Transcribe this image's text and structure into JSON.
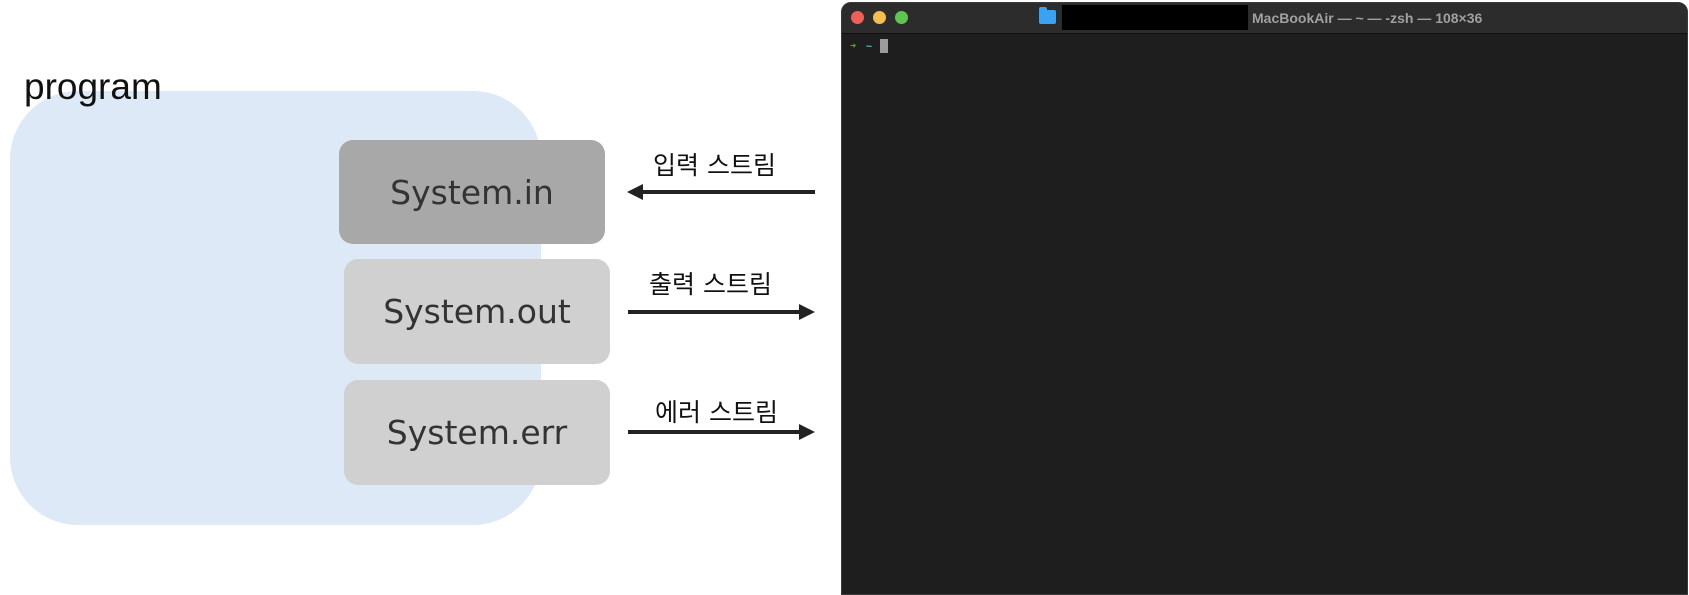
{
  "diagram": {
    "program_label": "program",
    "streams": [
      {
        "box_label": "System.in",
        "arrow_label": "입력 스트림",
        "direction": "into-program"
      },
      {
        "box_label": "System.out",
        "arrow_label": "출력 스트림",
        "direction": "out-of-program"
      },
      {
        "box_label": "System.err",
        "arrow_label": "에러 스트림",
        "direction": "out-of-program"
      }
    ]
  },
  "terminal": {
    "title": "MacBookAir — ~ — -zsh — 108×36",
    "prompt_arrow": "➜",
    "prompt_path": "~",
    "colors": {
      "background": "#1e1e1e",
      "titlebar": "#2c2c2c",
      "close": "#ed5f57",
      "minimize": "#f4bd4f",
      "maximize": "#5fc454"
    },
    "icons": [
      "folder-icon",
      "close-button",
      "minimize-button",
      "maximize-button"
    ]
  }
}
